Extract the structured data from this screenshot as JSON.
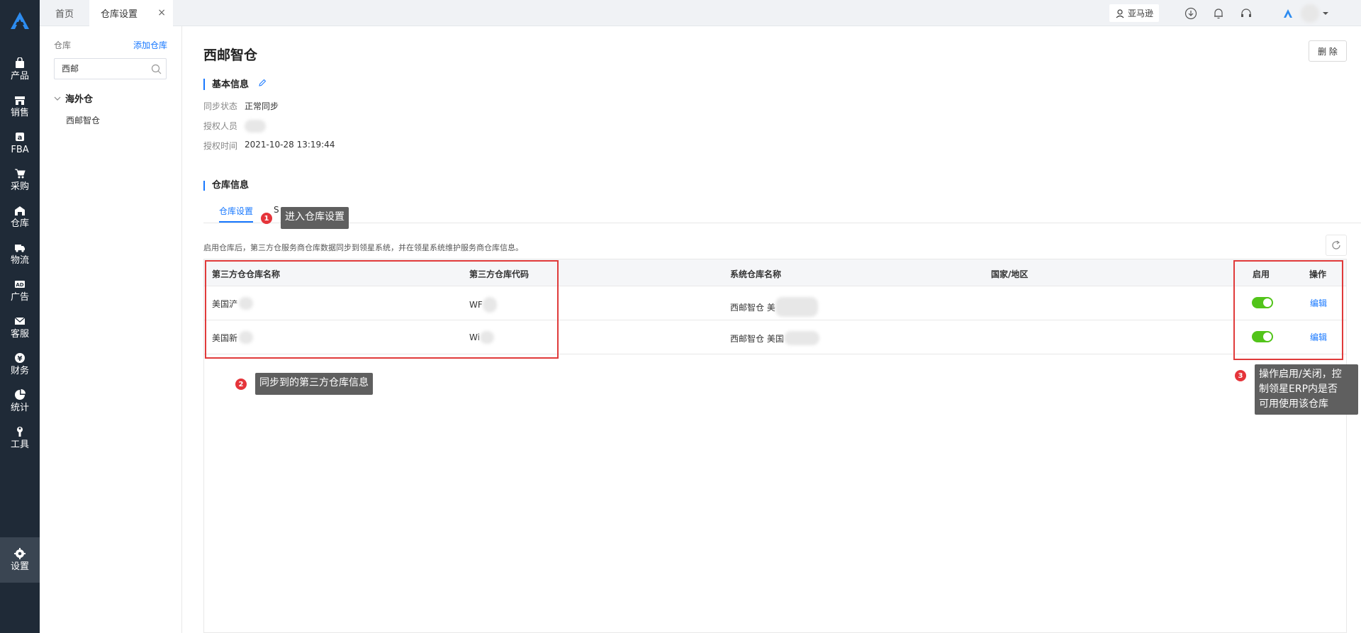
{
  "rail": {
    "items": [
      {
        "label": "产品",
        "icon": "bag-icon"
      },
      {
        "label": "销售",
        "icon": "store-icon"
      },
      {
        "label": "FBA",
        "icon": "a-box-icon"
      },
      {
        "label": "采购",
        "icon": "cart-icon"
      },
      {
        "label": "仓库",
        "icon": "warehouse-icon"
      },
      {
        "label": "物流",
        "icon": "truck-icon"
      },
      {
        "label": "广告",
        "icon": "ad-icon"
      },
      {
        "label": "客服",
        "icon": "mail-icon"
      },
      {
        "label": "财务",
        "icon": "coin-icon"
      },
      {
        "label": "统计",
        "icon": "pie-icon"
      },
      {
        "label": "工具",
        "icon": "wrench-icon"
      },
      {
        "label": "设置",
        "icon": "gear-icon"
      }
    ]
  },
  "topbar": {
    "tabs": [
      {
        "label": "首页"
      },
      {
        "label": "仓库设置"
      }
    ],
    "close": "×",
    "amazon_btn": "亚马逊"
  },
  "sidebar": {
    "header": "仓库",
    "add": "添加仓库",
    "search_value": "西邮",
    "group": "海外仓",
    "item": "西邮智仓"
  },
  "main": {
    "title": "西邮智仓",
    "delete": "删 除",
    "basic_title": "基本信息",
    "fields": [
      {
        "k": "同步状态",
        "v": "正常同步"
      },
      {
        "k": "授权人员",
        "v": ""
      },
      {
        "k": "授权时间",
        "v": "2021-10-28 13:19:44"
      }
    ],
    "wh_title": "仓库信息",
    "tab": "仓库设置",
    "tab_extra": "S",
    "note": "启用仓库后，第三方仓服务商仓库数据同步到领星系统，并在领星系统维护服务商仓库信息。",
    "columns": [
      "第三方仓仓库名称",
      "第三方仓库代码",
      "系统仓库名称",
      "国家/地区",
      "启用",
      "操作"
    ],
    "rows": [
      {
        "name": "美国浐",
        "code": "WF",
        "sys": "西邮智仓 美",
        "country": "",
        "enabled": true,
        "op": "编辑"
      },
      {
        "name": "美国新",
        "code": "Wi",
        "sys": "西邮智仓 美国",
        "country": "",
        "enabled": true,
        "op": "编辑"
      }
    ]
  },
  "annotations": {
    "c1": {
      "num": "1",
      "text": "进入仓库设置"
    },
    "c2": {
      "num": "2",
      "text": "同步到的第三方仓库信息"
    },
    "c3": {
      "num": "3",
      "lines": [
        "操作启用/关闭，控",
        "制领星ERP内是否",
        "可用使用该仓库"
      ]
    }
  },
  "colors": {
    "accent": "#1677ff",
    "rail": "#1f2a37",
    "switch_on": "#52c41a",
    "annotation_red": "#e03a3a"
  }
}
